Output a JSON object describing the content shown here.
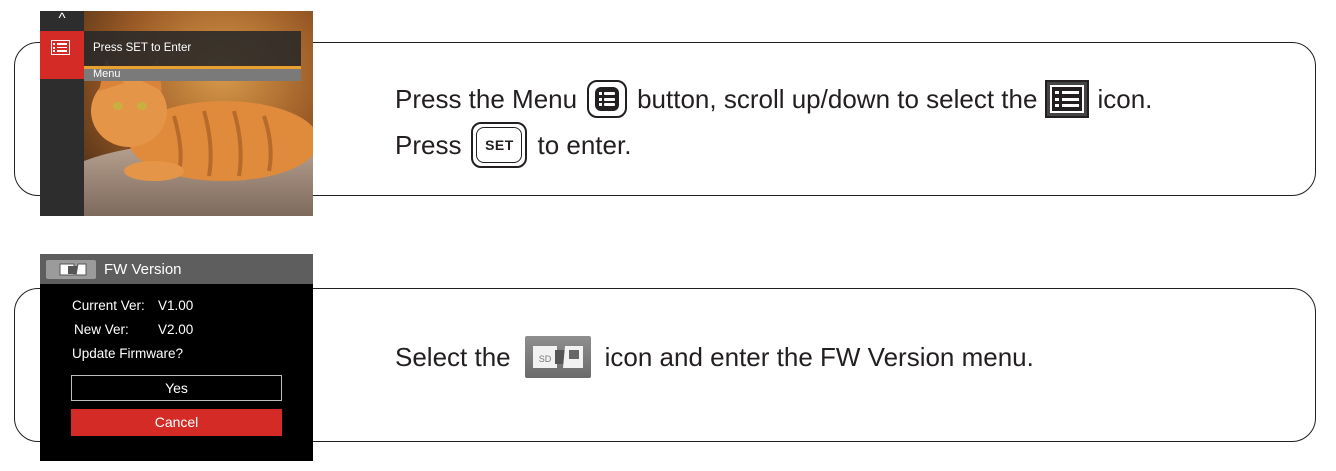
{
  "menu_screen": {
    "header_text": "Press SET to Enter",
    "sub_text": "Menu",
    "up_arrow": "^",
    "icons": {
      "list": "list-menu-icon",
      "up": "chevron-up-icon"
    }
  },
  "fw_screen": {
    "title": "FW Version",
    "current_ver_label": "Current Ver:",
    "current_ver_value": "V1.00",
    "new_ver_label": "New Ver:",
    "new_ver_value": "V2.00",
    "update_prompt": "Update Firmware?",
    "yes_label": "Yes",
    "cancel_label": "Cancel",
    "colors": {
      "selected": "#d42b27",
      "titlebar": "#5e5e5e"
    }
  },
  "step1": {
    "line1_a": "Press the Menu",
    "line1_b": "button, scroll up/down to select the",
    "line1_c": "icon.",
    "line2_a": "Press",
    "set_key": "SET",
    "line2_b": "to enter."
  },
  "step2": {
    "text_a": "Select the",
    "text_b": "icon and enter the FW Version menu.",
    "icon_text": "SD"
  }
}
